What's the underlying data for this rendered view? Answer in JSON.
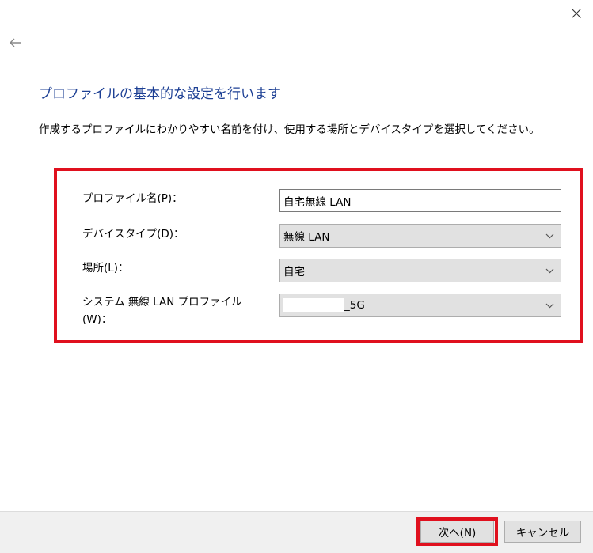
{
  "page": {
    "title": "プロファイルの基本的な設定を行います",
    "description": "作成するプロファイルにわかりやすい名前を付け、使用する場所とデバイスタイプを選択してください。"
  },
  "form": {
    "profile_name": {
      "label": "プロファイル名(P)：",
      "value": "自宅無線 LAN"
    },
    "device_type": {
      "label": "デバイスタイプ(D)：",
      "value": "無線 LAN"
    },
    "location": {
      "label": "場所(L)：",
      "value": "自宅"
    },
    "system_profile": {
      "label": "システム 無線 LAN プロファイル(W)：",
      "value": "_5G"
    }
  },
  "buttons": {
    "next": "次へ(N)",
    "cancel": "キャンセル"
  },
  "icons": {
    "close": "close-icon",
    "back": "back-arrow-icon",
    "dropdown": "chevron-down-icon"
  },
  "colors": {
    "title": "#1c3f94",
    "highlight": "#e0101e",
    "footer": "#f0f0f0"
  }
}
